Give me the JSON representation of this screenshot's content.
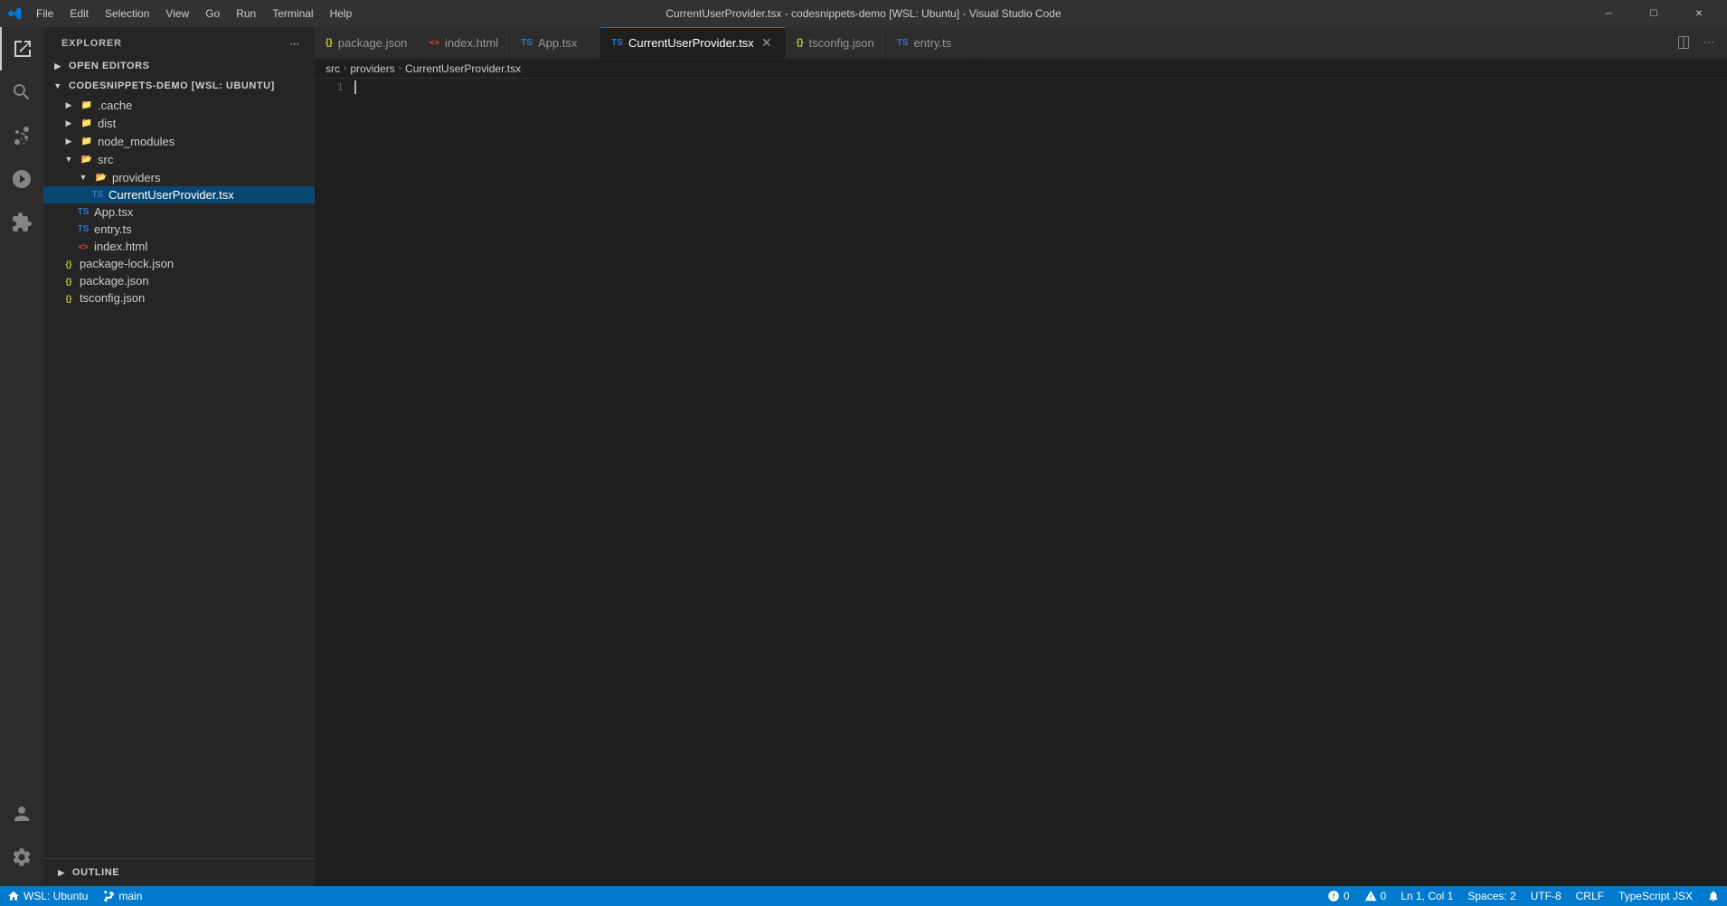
{
  "titleBar": {
    "title": "CurrentUserProvider.tsx - codesnippets-demo [WSL: Ubuntu] - Visual Studio Code",
    "menuItems": [
      "File",
      "Edit",
      "Selection",
      "View",
      "Go",
      "Run",
      "Terminal",
      "Help"
    ]
  },
  "activityBar": {
    "items": [
      {
        "name": "explorer",
        "label": "Explorer"
      },
      {
        "name": "search",
        "label": "Search"
      },
      {
        "name": "source-control",
        "label": "Source Control"
      },
      {
        "name": "run-debug",
        "label": "Run and Debug"
      },
      {
        "name": "extensions",
        "label": "Extensions"
      }
    ],
    "bottomItems": [
      {
        "name": "account",
        "label": "Account"
      },
      {
        "name": "settings",
        "label": "Settings"
      }
    ]
  },
  "sidebar": {
    "title": "EXPLORER",
    "sections": {
      "openEditors": {
        "label": "OPEN EDITORS",
        "collapsed": true
      },
      "project": {
        "label": "CODESNIPPETS-DEMO [WSL: UBUNTU]",
        "items": [
          {
            "id": "cache",
            "label": ".cache",
            "type": "folder",
            "indent": 1,
            "collapsed": true
          },
          {
            "id": "dist",
            "label": "dist",
            "type": "folder",
            "indent": 1,
            "collapsed": true
          },
          {
            "id": "node_modules",
            "label": "node_modules",
            "type": "folder",
            "indent": 1,
            "collapsed": true
          },
          {
            "id": "src",
            "label": "src",
            "type": "folder",
            "indent": 1,
            "expanded": true
          },
          {
            "id": "providers",
            "label": "providers",
            "type": "folder",
            "indent": 2,
            "expanded": true
          },
          {
            "id": "CurrentUserProvider",
            "label": "CurrentUserProvider.tsx",
            "type": "tsx",
            "indent": 3,
            "selected": true
          },
          {
            "id": "App",
            "label": "App.tsx",
            "type": "tsx",
            "indent": 2
          },
          {
            "id": "entry",
            "label": "entry.ts",
            "type": "ts",
            "indent": 2
          },
          {
            "id": "index",
            "label": "index.html",
            "type": "html",
            "indent": 2
          },
          {
            "id": "package-lock",
            "label": "package-lock.json",
            "type": "json",
            "indent": 1
          },
          {
            "id": "package",
            "label": "package.json",
            "type": "json",
            "indent": 1
          },
          {
            "id": "tsconfig",
            "label": "tsconfig.json",
            "type": "json",
            "indent": 1
          }
        ]
      }
    },
    "outline": {
      "label": "OUTLINE"
    }
  },
  "tabs": [
    {
      "label": "package.json",
      "type": "json",
      "active": false,
      "closable": false
    },
    {
      "label": "index.html",
      "type": "html",
      "active": false,
      "closable": false
    },
    {
      "label": "App.tsx",
      "type": "tsx",
      "active": false,
      "closable": false
    },
    {
      "label": "CurrentUserProvider.tsx",
      "type": "tsx",
      "active": true,
      "closable": true
    },
    {
      "label": "tsconfig.json",
      "type": "json",
      "active": false,
      "closable": false
    },
    {
      "label": "entry.ts",
      "type": "ts",
      "active": false,
      "closable": false
    }
  ],
  "breadcrumb": {
    "items": [
      "src",
      "providers",
      "CurrentUserProvider.tsx"
    ]
  },
  "editor": {
    "lineNumbers": [
      "1"
    ],
    "content": ""
  },
  "statusBar": {
    "left": [
      {
        "icon": "remote-icon",
        "text": "WSL: Ubuntu"
      },
      {
        "icon": "branch-icon",
        "text": "main"
      }
    ],
    "right": [
      {
        "text": "Ln 1, Col 1"
      },
      {
        "text": "Spaces: 2"
      },
      {
        "text": "UTF-8"
      },
      {
        "text": "CRLF"
      },
      {
        "text": "TypeScript JSX"
      },
      {
        "icon": "bell-icon",
        "text": ""
      },
      {
        "icon": "error-icon",
        "text": "0"
      },
      {
        "icon": "warning-icon",
        "text": "0"
      }
    ]
  }
}
